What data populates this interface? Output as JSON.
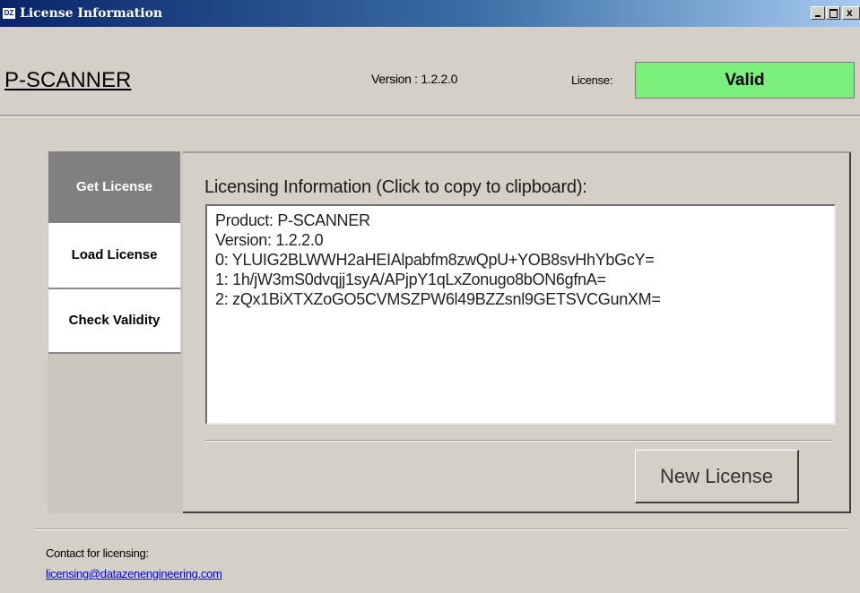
{
  "window": {
    "title": "License Information",
    "icon_text": "DZ",
    "close_glyph": "x"
  },
  "header": {
    "app_name": "P-SCANNER",
    "version_text": "Version : 1.2.2.0",
    "license_label": "License:",
    "license_status": "Valid",
    "license_status_color": "#7bef7b"
  },
  "tabs": [
    {
      "label": "Get License",
      "active": true
    },
    {
      "label": "Load License",
      "active": false
    },
    {
      "label": "Check Validity",
      "active": false
    }
  ],
  "content": {
    "heading": "Licensing Information (Click to copy to clipboard):",
    "info_lines": [
      "Product: P-SCANNER",
      "Version: 1.2.2.0",
      "0: YLUIG2BLWWH2aHEIAlpabfm8zwQpU+YOB8svHhYbGcY=",
      "1: 1h/jW3mS0dvqjj1syA/APjpY1qLxZonugo8bON6gfnA=",
      "2: zQx1BiXTXZoGO5CVMSZPW6l49BZZsnl9GETSVCGunXM="
    ],
    "new_license_button": "New License"
  },
  "footer": {
    "contact_label": "Contact for licensing:",
    "contact_email": "licensing@datazenengineering.com"
  }
}
